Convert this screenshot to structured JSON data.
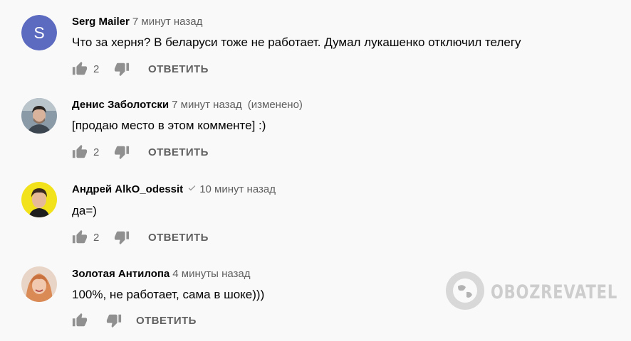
{
  "comments": [
    {
      "author": "Serg Mailer",
      "time": "7 минут назад",
      "edited": "",
      "avatar_letter": "S",
      "avatar_color": "#5c6bc0",
      "text": "Что за херня? В беларуси тоже не работает.  Думал лукашенко отключил телегу",
      "likes": "2",
      "reply_label": "ОТВЕТИТЬ"
    },
    {
      "author": "Денис Заболотски",
      "time": "7 минут назад",
      "edited": "(изменено)",
      "text": "[продаю место в этом комменте] :)",
      "likes": "2",
      "reply_label": "ОТВЕТИТЬ"
    },
    {
      "author": "Андрей AlkO_odessit",
      "time": "10 минут назад",
      "edited": "",
      "verified": true,
      "text": "да=)",
      "likes": "2",
      "reply_label": "ОТВЕТИТЬ"
    },
    {
      "author": "Золотая Антилопа",
      "time": "4 минуты назад",
      "edited": "",
      "text": "100%, не работает, сама в шоке)))",
      "likes": "",
      "reply_label": "ОТВЕТИТЬ"
    }
  ],
  "watermark": {
    "logo": "OBOZREVATEL"
  },
  "colors": {
    "background": "#f9f9f9",
    "text": "#030303",
    "secondary": "#606060",
    "icon": "#909090"
  },
  "icons": {
    "like": "thumbs-up-icon",
    "dislike": "thumbs-down-icon",
    "verified": "checkmark-icon"
  }
}
